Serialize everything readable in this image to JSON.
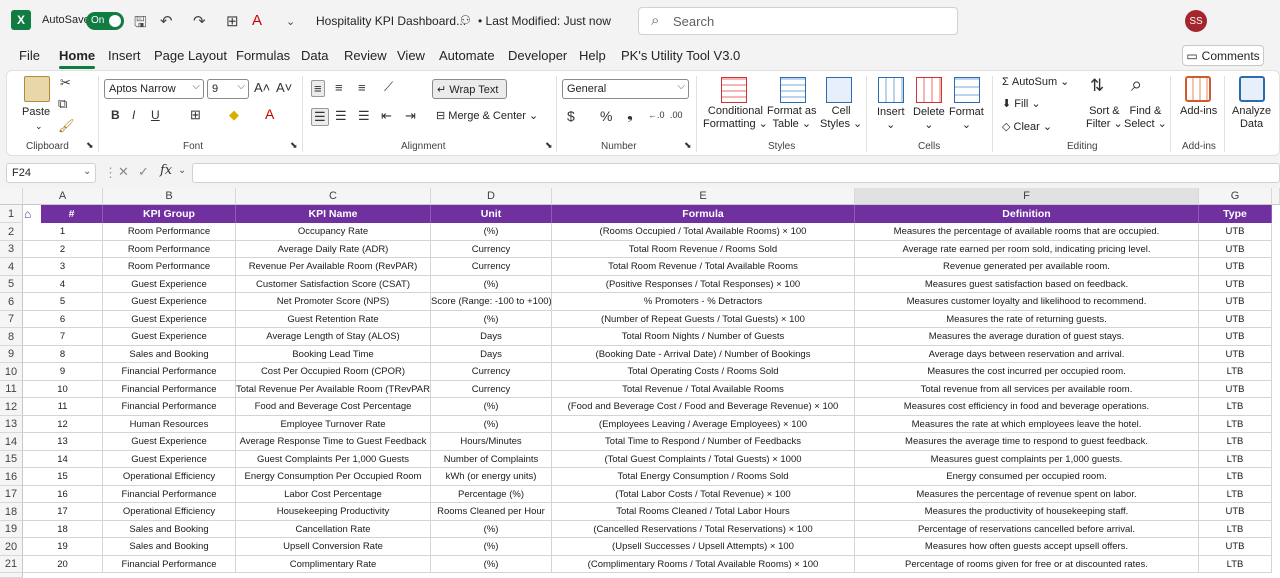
{
  "titlebar": {
    "logo": "X",
    "autosave_label": "AutoSave",
    "autosave_state": "On",
    "doc_title": "Hospitality KPI Dashboard...",
    "last_modified": "• Last Modified: Just now",
    "search_placeholder": "Search",
    "avatar_initials": "SS"
  },
  "menu": {
    "tabs": [
      "File",
      "Home",
      "Insert",
      "Page Layout",
      "Formulas",
      "Data",
      "Review",
      "View",
      "Automate",
      "Developer",
      "Help",
      "PK's Utility Tool V3.0"
    ],
    "active": "Home",
    "comments": "Comments"
  },
  "ribbon": {
    "paste": "Paste",
    "clipboard": "Clipboard",
    "font_name": "Aptos Narrow",
    "font_size": "9",
    "font": "Font",
    "wrap_text": "Wrap Text",
    "merge_center": "Merge & Center",
    "alignment": "Alignment",
    "number_format": "General",
    "number": "Number",
    "conditional_formatting": [
      "Conditional",
      "Formatting"
    ],
    "format_as_table": [
      "Format as",
      "Table"
    ],
    "cell_styles": [
      "Cell",
      "Styles"
    ],
    "styles": "Styles",
    "insert": "Insert",
    "delete": "Delete",
    "format": "Format",
    "cells": "Cells",
    "autosum": "AutoSum",
    "fill": "Fill",
    "clear": "Clear",
    "sort_filter": [
      "Sort &",
      "Filter"
    ],
    "find_select": [
      "Find &",
      "Select"
    ],
    "editing": "Editing",
    "addins": "Add-ins",
    "addins_group": "Add-ins",
    "analyze": [
      "Analyze",
      "Data"
    ]
  },
  "formula_bar": {
    "name_box": "F24",
    "fx": "fx",
    "formula": ""
  },
  "sheet": {
    "columns": [
      "A",
      "B",
      "C",
      "D",
      "E",
      "F",
      "G"
    ],
    "header": [
      "#",
      "KPI Group",
      "KPI Name",
      "Unit",
      "Formula",
      "Definition",
      "Type"
    ],
    "rows": [
      [
        "1",
        "Room Performance",
        "Occupancy Rate",
        "(%)",
        "(Rooms Occupied / Total Available Rooms) × 100",
        "Measures the percentage of available rooms that are occupied.",
        "UTB"
      ],
      [
        "2",
        "Room Performance",
        "Average Daily Rate (ADR)",
        "Currency",
        "Total Room Revenue / Rooms Sold",
        "Average rate earned per room sold, indicating pricing level.",
        "UTB"
      ],
      [
        "3",
        "Room Performance",
        "Revenue Per Available Room (RevPAR)",
        "Currency",
        "Total Room Revenue / Total Available Rooms",
        "Revenue generated per available room.",
        "UTB"
      ],
      [
        "4",
        "Guest Experience",
        "Customer Satisfaction Score (CSAT)",
        "(%)",
        "(Positive Responses / Total Responses) × 100",
        "Measures guest satisfaction based on feedback.",
        "UTB"
      ],
      [
        "5",
        "Guest Experience",
        "Net Promoter Score (NPS)",
        "Score (Range: -100 to +100)",
        "% Promoters - % Detractors",
        "Measures customer loyalty and likelihood to recommend.",
        "UTB"
      ],
      [
        "6",
        "Guest Experience",
        "Guest Retention Rate",
        "(%)",
        "(Number of Repeat Guests / Total Guests) × 100",
        "Measures the rate of returning guests.",
        "UTB"
      ],
      [
        "7",
        "Guest Experience",
        "Average Length of Stay (ALOS)",
        "Days",
        "Total Room Nights / Number of Guests",
        "Measures the average duration of guest stays.",
        "UTB"
      ],
      [
        "8",
        "Sales and Booking",
        "Booking Lead Time",
        "Days",
        "(Booking Date - Arrival Date) / Number of Bookings",
        "Average days between reservation and arrival.",
        "UTB"
      ],
      [
        "9",
        "Financial Performance",
        "Cost Per Occupied Room (CPOR)",
        "Currency",
        "Total Operating Costs / Rooms Sold",
        "Measures the cost incurred per occupied room.",
        "LTB"
      ],
      [
        "10",
        "Financial Performance",
        "Total Revenue Per Available Room (TRevPAR)",
        "Currency",
        "Total Revenue / Total Available Rooms",
        "Total revenue from all services per available room.",
        "UTB"
      ],
      [
        "11",
        "Financial Performance",
        "Food and Beverage Cost Percentage",
        "(%)",
        "(Food and Beverage Cost / Food and Beverage Revenue) × 100",
        "Measures cost efficiency in food and beverage operations.",
        "LTB"
      ],
      [
        "12",
        "Human Resources",
        "Employee Turnover Rate",
        "(%)",
        "(Employees Leaving / Average Employees) × 100",
        "Measures the rate at which employees leave the hotel.",
        "LTB"
      ],
      [
        "13",
        "Guest Experience",
        "Average Response Time to Guest Feedback",
        "Hours/Minutes",
        "Total Time to Respond / Number of Feedbacks",
        "Measures the average time to respond to guest feedback.",
        "LTB"
      ],
      [
        "14",
        "Guest Experience",
        "Guest Complaints Per 1,000 Guests",
        "Number of Complaints",
        "(Total Guest Complaints / Total Guests) × 1000",
        "Measures guest complaints per 1,000 guests.",
        "LTB"
      ],
      [
        "15",
        "Operational Efficiency",
        "Energy Consumption Per Occupied Room",
        "kWh (or energy units)",
        "Total Energy Consumption / Rooms Sold",
        "Energy consumed per occupied room.",
        "LTB"
      ],
      [
        "16",
        "Financial Performance",
        "Labor Cost Percentage",
        "Percentage (%)",
        "(Total Labor Costs / Total Revenue) × 100",
        "Measures the percentage of revenue spent on labor.",
        "LTB"
      ],
      [
        "17",
        "Operational Efficiency",
        "Housekeeping Productivity",
        "Rooms Cleaned per Hour",
        "Total Rooms Cleaned / Total Labor Hours",
        "Measures the productivity of housekeeping staff.",
        "UTB"
      ],
      [
        "18",
        "Sales and Booking",
        "Cancellation Rate",
        "(%)",
        "(Cancelled Reservations / Total Reservations) × 100",
        "Percentage of reservations cancelled before arrival.",
        "LTB"
      ],
      [
        "19",
        "Sales and Booking",
        "Upsell Conversion Rate",
        "(%)",
        "(Upsell Successes / Upsell Attempts) × 100",
        "Measures how often guests accept upsell offers.",
        "UTB"
      ],
      [
        "20",
        "Financial Performance",
        "Complimentary Rate",
        "(%)",
        "(Complimentary Rooms / Total Available Rooms) × 100",
        "Percentage of rooms given for free or at discounted rates.",
        "LTB"
      ]
    ]
  },
  "colors": {
    "header_bg": "#7030a0",
    "accent": "#107c41"
  }
}
